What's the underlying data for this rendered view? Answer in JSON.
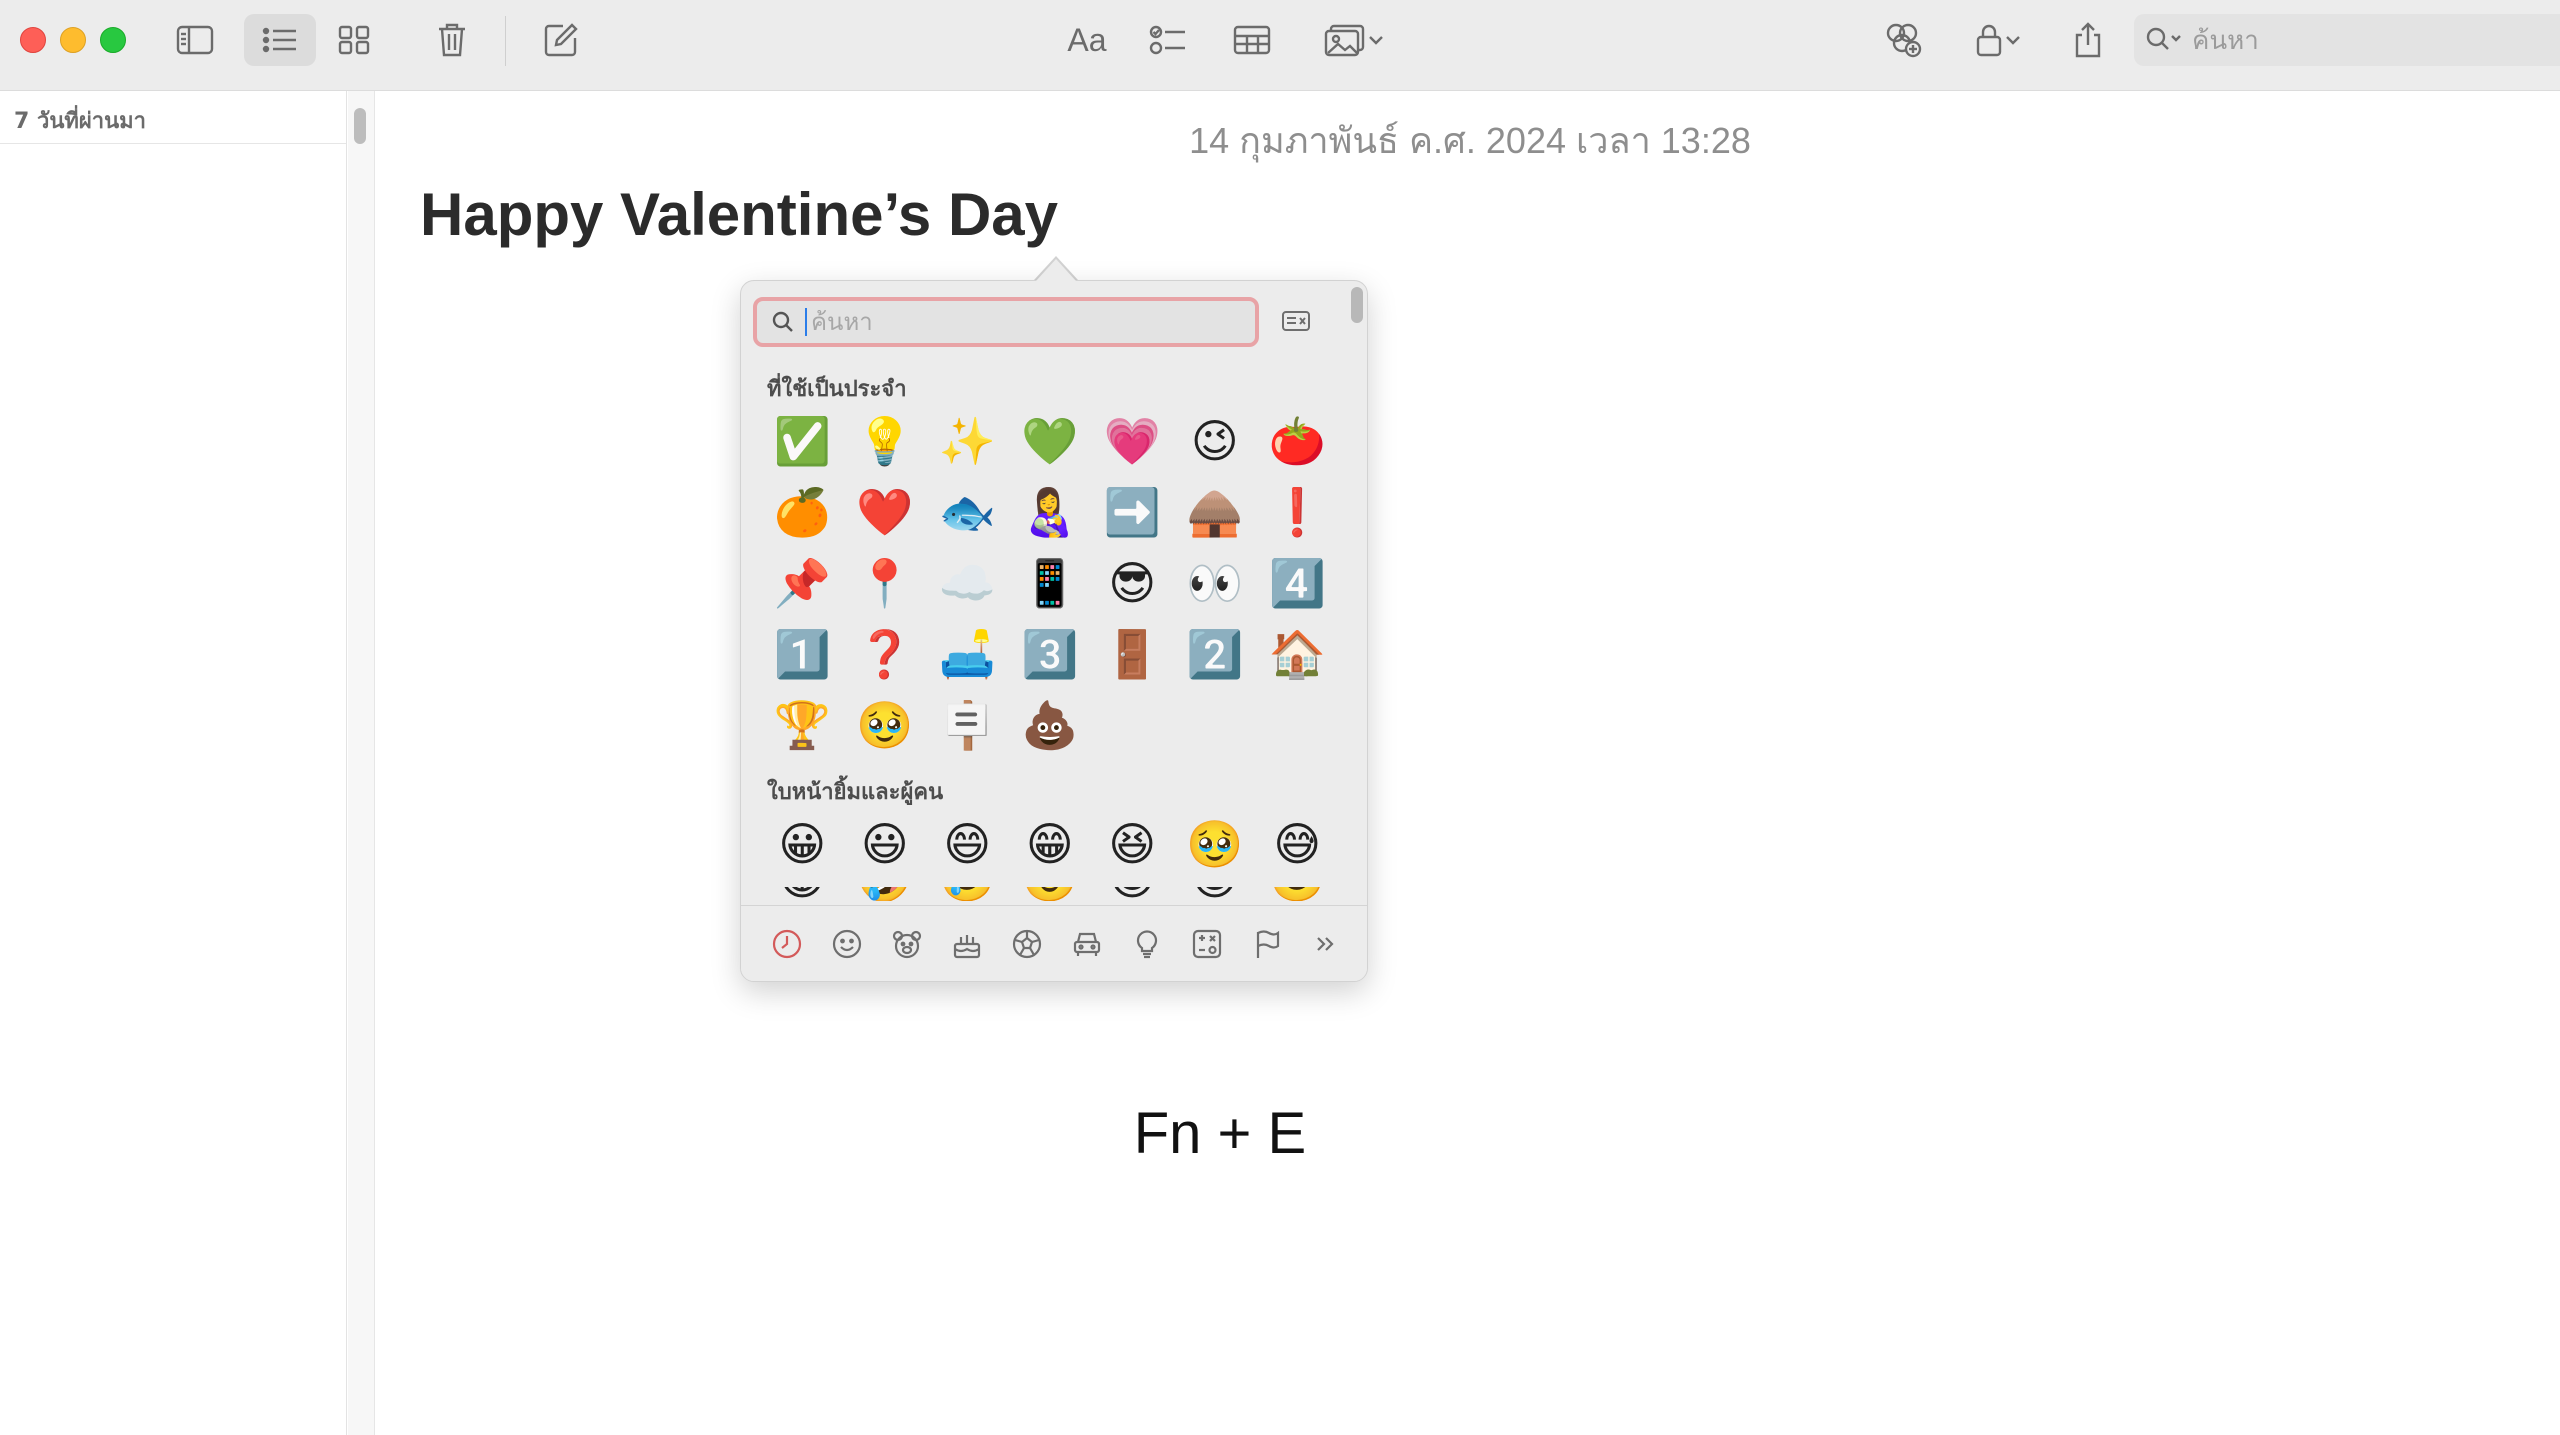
{
  "toolbar": {
    "format_label": "Aa",
    "search_placeholder": "ค้นหา",
    "colors": {
      "background": "#ececec",
      "icon": "#6b6b6b"
    }
  },
  "sidebar": {
    "section_label": "7 วันที่ผ่านมา"
  },
  "note": {
    "date": "14 กุมภาพันธ์ ค.ศ. 2024 เวลา 13:28",
    "title": "Happy Valentine’s Day",
    "body": "Fn + E"
  },
  "emoji_picker": {
    "search_placeholder": "ค้นหา",
    "search_border_color": "#e8a3a6",
    "frequently_used_label": "ที่ใช้เป็นประจำ",
    "frequently_used": [
      "✅",
      "💡",
      "✨",
      "💚",
      "💗",
      "😉",
      "🍅",
      "🍊",
      "❤️",
      "🐟",
      "👩‍🍼",
      "➡️",
      "🛖",
      "❗",
      "📌",
      "📍",
      "☁️",
      "📱",
      "😎",
      "👀",
      "4️⃣",
      "1️⃣",
      "❓",
      "🛋️",
      "3️⃣",
      "🚪",
      "2️⃣",
      "🏠",
      "🏆",
      "🥹",
      "🪧",
      "💩"
    ],
    "smileys_label": "ใบหน้ายิ้มและผู้คน",
    "smileys": [
      "😀",
      "😃",
      "😄",
      "😁",
      "😆",
      "🥹",
      "😅"
    ],
    "smileys_partial": [
      "😂",
      "🤣",
      "🥲",
      "☺️",
      "😊",
      "😇",
      "🙂"
    ],
    "categories": [
      "recent-clock-icon",
      "smiley-face-icon",
      "bear-icon",
      "food-cake-icon",
      "soccer-ball-icon",
      "car-icon",
      "lightbulb-icon",
      "symbols-icon",
      "flag-icon",
      "more-chevrons-icon"
    ]
  }
}
